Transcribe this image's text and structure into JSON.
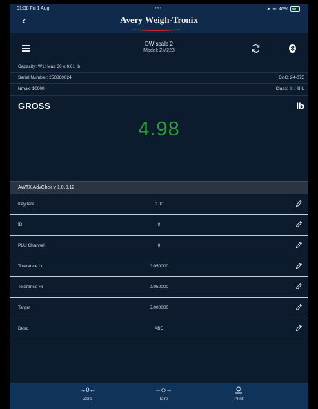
{
  "status_bar": {
    "time": "01:38  Fri 1 Aug",
    "dots": "•••",
    "battery": "46%"
  },
  "nav": {
    "back_glyph": "‹",
    "logo_text": "Avery Weigh-Tronix"
  },
  "header": {
    "scale_name": "DW scale 2",
    "model": "Model: ZM223"
  },
  "info": {
    "capacity": "Capacity: W1: Max 30 x 0.01 lb",
    "serial": "Serial Number: 250860024",
    "coc": "CoC: 24-075",
    "nmax": "Nmax: 10000",
    "class": "Class: III / III L"
  },
  "weight": {
    "mode": "GROSS",
    "unit": "lb",
    "value": "4.98",
    "value_color": "#2f9a3a"
  },
  "app": {
    "title": "AWTX AdvChck v 1.0.0.12",
    "rows": [
      {
        "label": "KeyTare",
        "value": "0.00"
      },
      {
        "label": "ID",
        "value": "0"
      },
      {
        "label": "PLU Channel",
        "value": "0"
      },
      {
        "label": "Tolerance Lo",
        "value": "0.050000"
      },
      {
        "label": "Tolerance Hi",
        "value": "0.050000"
      },
      {
        "label": "Target",
        "value": "5.000000"
      },
      {
        "label": "Desc",
        "value": "ABC"
      }
    ]
  },
  "toolbar": {
    "zero": {
      "icon": "→0←",
      "label": "Zero"
    },
    "tare": {
      "icon": "←◇→",
      "label": "Tare"
    },
    "print": {
      "label": "Print"
    }
  }
}
